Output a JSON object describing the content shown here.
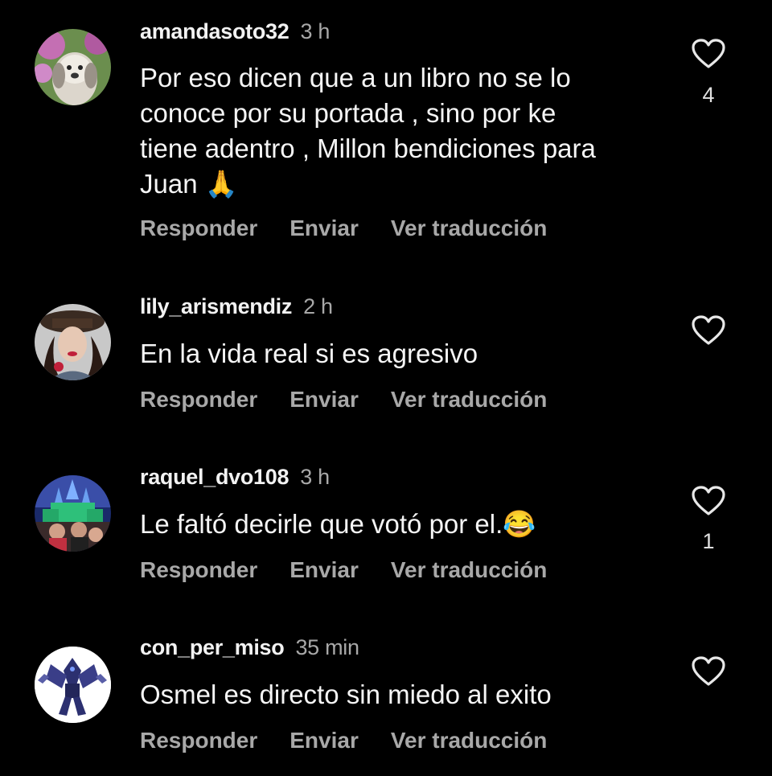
{
  "comments": [
    {
      "username": "amandasoto32",
      "time": "3 h",
      "text": "Por eso dicen que a un libro no se lo\nconoce por su portada , sino por ke\ntiene adentro , Millon bendiciones para\nJuan 🙏",
      "actions": {
        "reply": "Responder",
        "send": "Enviar",
        "translate": "Ver traducción"
      },
      "likes": "4"
    },
    {
      "username": "lily_arismendiz",
      "time": "2 h",
      "text": "En la vida real si es agresivo",
      "actions": {
        "reply": "Responder",
        "send": "Enviar",
        "translate": "Ver traducción"
      },
      "likes": ""
    },
    {
      "username": "raquel_dvo108",
      "time": "3 h",
      "text": "Le faltó decirle que votó por el.😂",
      "actions": {
        "reply": "Responder",
        "send": "Enviar",
        "translate": "Ver traducción"
      },
      "likes": "1"
    },
    {
      "username": "con_per_miso",
      "time": "35 min",
      "text": "Osmel es directo sin miedo al exito",
      "actions": {
        "reply": "Responder",
        "send": "Enviar",
        "translate": "Ver traducción"
      },
      "likes": ""
    }
  ],
  "icons": {
    "like": "heart-outline-icon"
  },
  "colors": {
    "background": "#000000",
    "primary_text": "#f5f5f5",
    "secondary_text": "#a8a8a8"
  }
}
